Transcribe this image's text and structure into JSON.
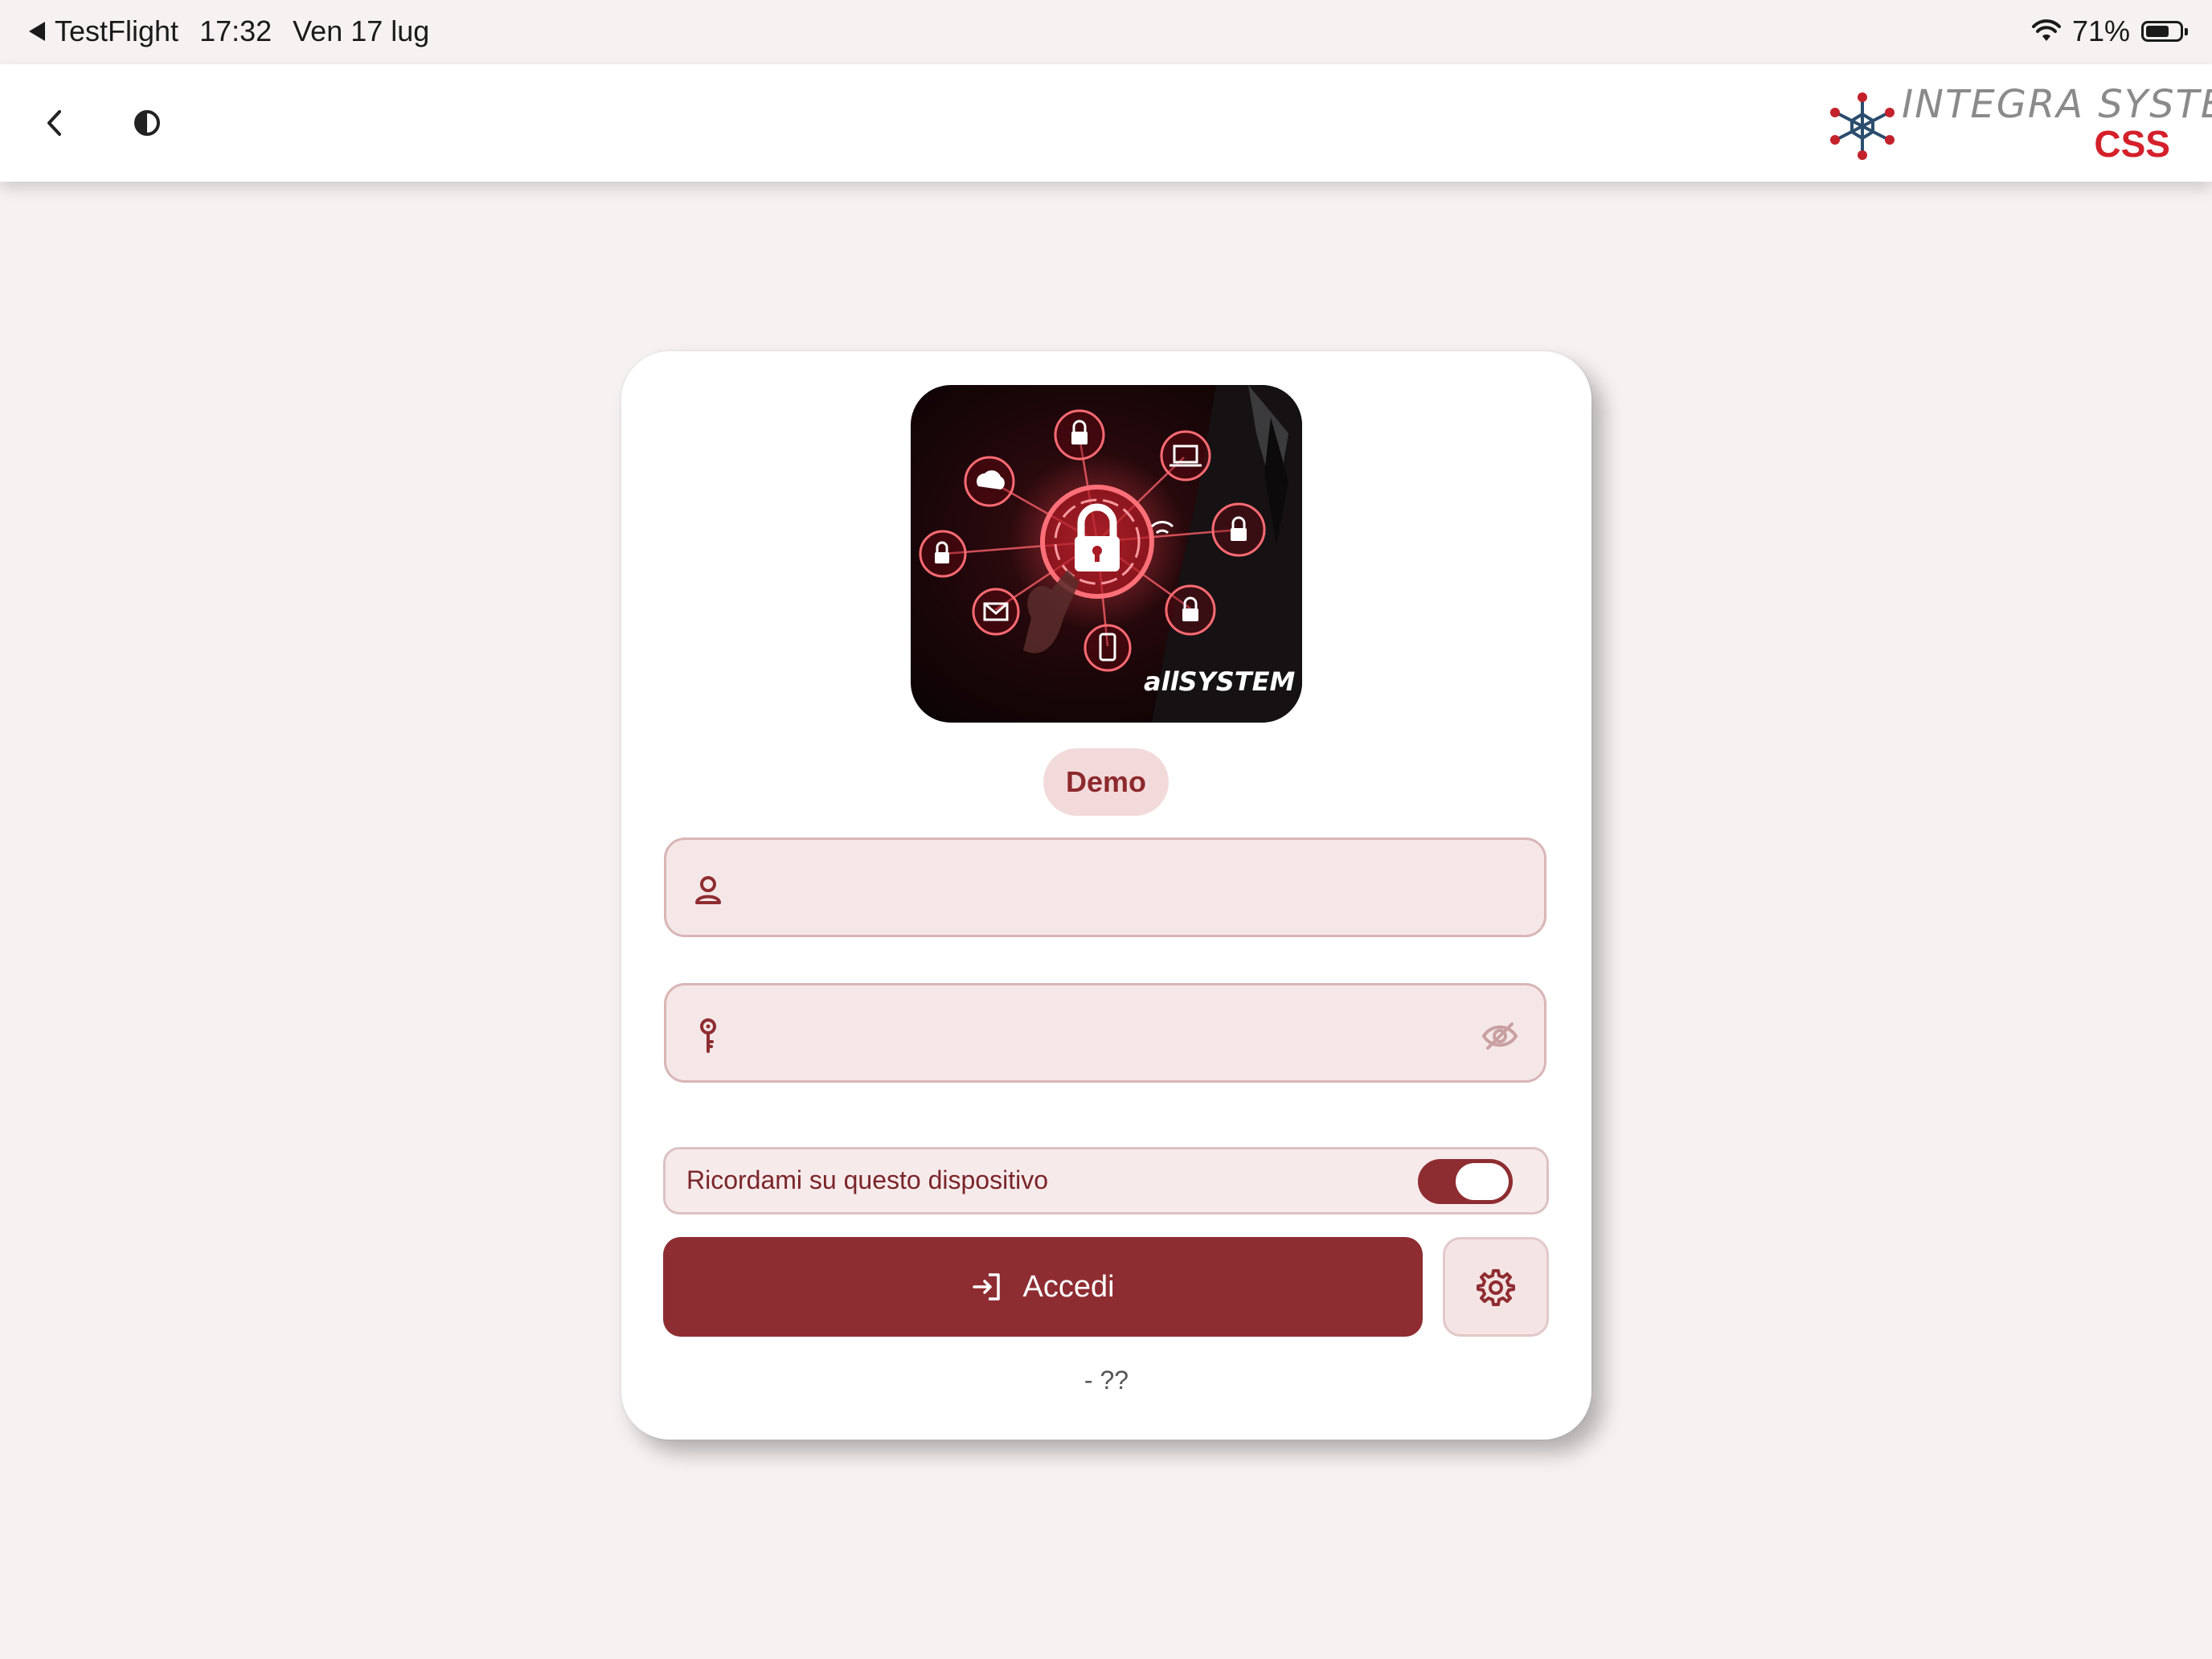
{
  "status_bar": {
    "back_app": "TestFlight",
    "time": "17:32",
    "date": "Ven 17 lug",
    "battery": "71%",
    "battery_level": 0.71
  },
  "app_bar": {
    "logo_text": "INTEGRA SYSTEM",
    "logo_sub": "CSS"
  },
  "hero": {
    "brand_text": "allSYSTEM"
  },
  "login": {
    "environment_badge": "Demo",
    "username_value": "",
    "password_value": "",
    "remember_label": "Ricordami su questo dispositivo",
    "remember_enabled": true,
    "login_label": "Accedi",
    "version_text": "- ??"
  },
  "colors": {
    "primary": "#8e2d31",
    "field_bg": "#f5e7e7",
    "page_bg": "#f6f2f1",
    "logo_red": "#d4202a"
  },
  "icons": {
    "back": "chevron-left-icon",
    "theme": "contrast-icon",
    "user": "user-icon",
    "key": "key-icon",
    "eye": "eye-off-icon",
    "login": "login-icon",
    "settings": "gear-icon"
  }
}
